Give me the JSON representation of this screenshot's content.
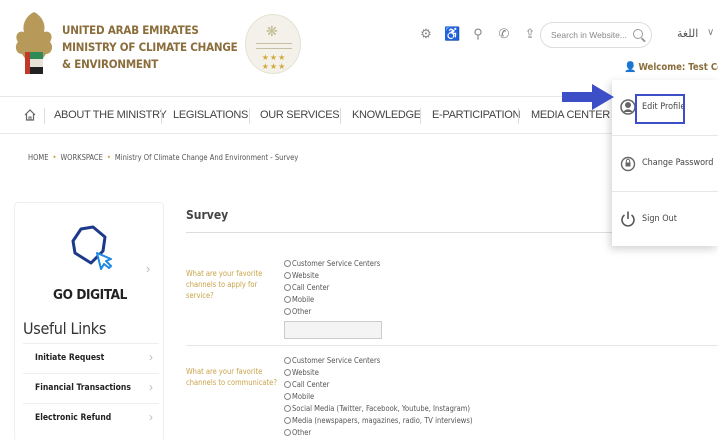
{
  "header": {
    "org_line1": "UNITED ARAB EMIRATES",
    "org_line2": "MINISTRY OF CLIMATE CHANGE",
    "org_line3": "& ENVIRONMENT",
    "icons": [
      "settings-icon",
      "accessibility-icon",
      "sitemap-icon",
      "phone-icon",
      "share-icon"
    ],
    "search_placeholder": "Search in Website...",
    "language_label": "اللغة",
    "welcome_text": "Welcome: Test Com"
  },
  "nav": {
    "items": [
      "ABOUT THE MINISTRY",
      "LEGISLATIONS",
      "OUR SERVICES",
      "KNOWLEDGE",
      "E-PARTICIPATION",
      "MEDIA CENTER"
    ]
  },
  "breadcrumb": {
    "items": [
      "HOME",
      "WORKSPACE",
      "Ministry Of Climate Change And Environment - Survey"
    ]
  },
  "sidebar": {
    "go_digital": "GO DIGITAL",
    "useful_links_title": "Useful Links",
    "links": [
      "Initiate Request",
      "Financial Transactions",
      "Electronic Refund"
    ]
  },
  "survey": {
    "title": "Survey",
    "questions": [
      {
        "text": "What are your favorite channels to apply for service?",
        "options": [
          "Customer Service Centers",
          "Website",
          "Call Center",
          "Mobile",
          "Other"
        ]
      },
      {
        "text": "What are your favorite channels to communicate?",
        "options": [
          "Customer Service Centers",
          "Website",
          "Call Center",
          "Mobile",
          "Social Media (Twitter, Facebook, Youtube, Instagram)",
          "Media (newspapers, magazines, radio, TV interviews)",
          "Other"
        ]
      }
    ]
  },
  "user_menu": {
    "items": [
      "Edit Profile",
      "Change Password",
      "Sign Out"
    ]
  },
  "colors": {
    "gold": "#c9a449",
    "brown": "#8a6d3b",
    "highlight_blue": "#3d4fc7"
  }
}
